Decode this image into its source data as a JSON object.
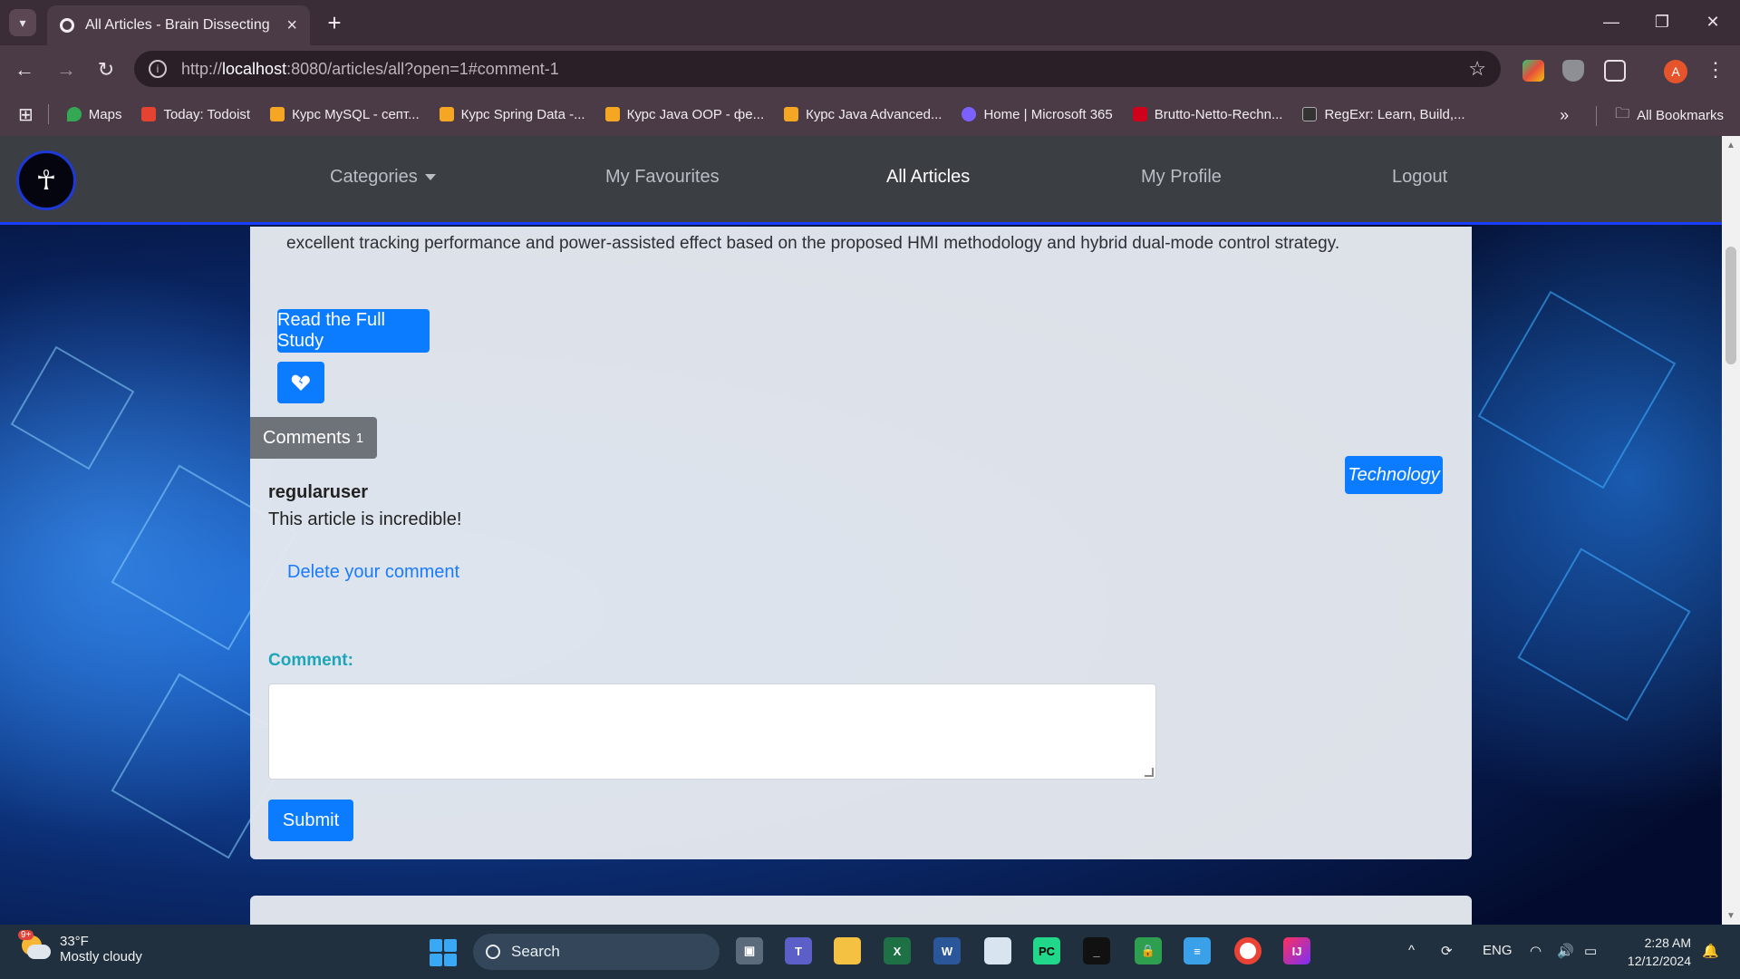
{
  "browser": {
    "tab_title": "All Articles - Brain Dissecting",
    "url_prefix": "http://",
    "url_host": "localhost",
    "url_rest": ":8080/articles/all?open=1#comment-1",
    "bookmarks": [
      {
        "label": "Maps",
        "color": "#34a853"
      },
      {
        "label": "Today: Todoist",
        "color": "#e44332"
      },
      {
        "label": "Курс MySQL - септ...",
        "color": "#f5a623"
      },
      {
        "label": "Курс Spring Data -...",
        "color": "#f5a623"
      },
      {
        "label": "Курс Java OOP - фе...",
        "color": "#f5a623"
      },
      {
        "label": "Курс Java Advanced...",
        "color": "#f5a623"
      },
      {
        "label": "Home | Microsoft 365",
        "color": "#7b61ff"
      },
      {
        "label": "Brutto-Netto-Rechn...",
        "color": "#d0021b"
      },
      {
        "label": "RegExr: Learn, Build,...",
        "color": "#333333"
      }
    ],
    "all_bookmarks": "All Bookmarks",
    "profile_initial": "A"
  },
  "site": {
    "nav": {
      "categories": "Categories",
      "favourites": "My Favourites",
      "all_articles": "All Articles",
      "profile": "My Profile",
      "logout": "Logout"
    }
  },
  "article": {
    "text_tail": "excellent tracking performance and power-assisted effect based on the proposed HMI methodology and hybrid dual-mode control strategy.",
    "read_button": "Read the Full Study",
    "category_badge": "Technology",
    "comments_label": "Comments",
    "comments_count": "1",
    "comments": [
      {
        "author": "regularuser",
        "text": "This article is incredible!"
      }
    ],
    "delete_link": "Delete your comment",
    "comment_label": "Comment:",
    "submit": "Submit"
  },
  "taskbar": {
    "weather_badge": "9+",
    "temperature": "33°F",
    "condition": "Mostly cloudy",
    "search": "Search",
    "language": "ENG",
    "time": "2:28 AM",
    "date": "12/12/2024"
  },
  "colors": {
    "accent": "#0b7bff",
    "nav_bg": "#3b3f44",
    "nav_border": "#1a3cff",
    "label_teal": "#1da6b8"
  }
}
